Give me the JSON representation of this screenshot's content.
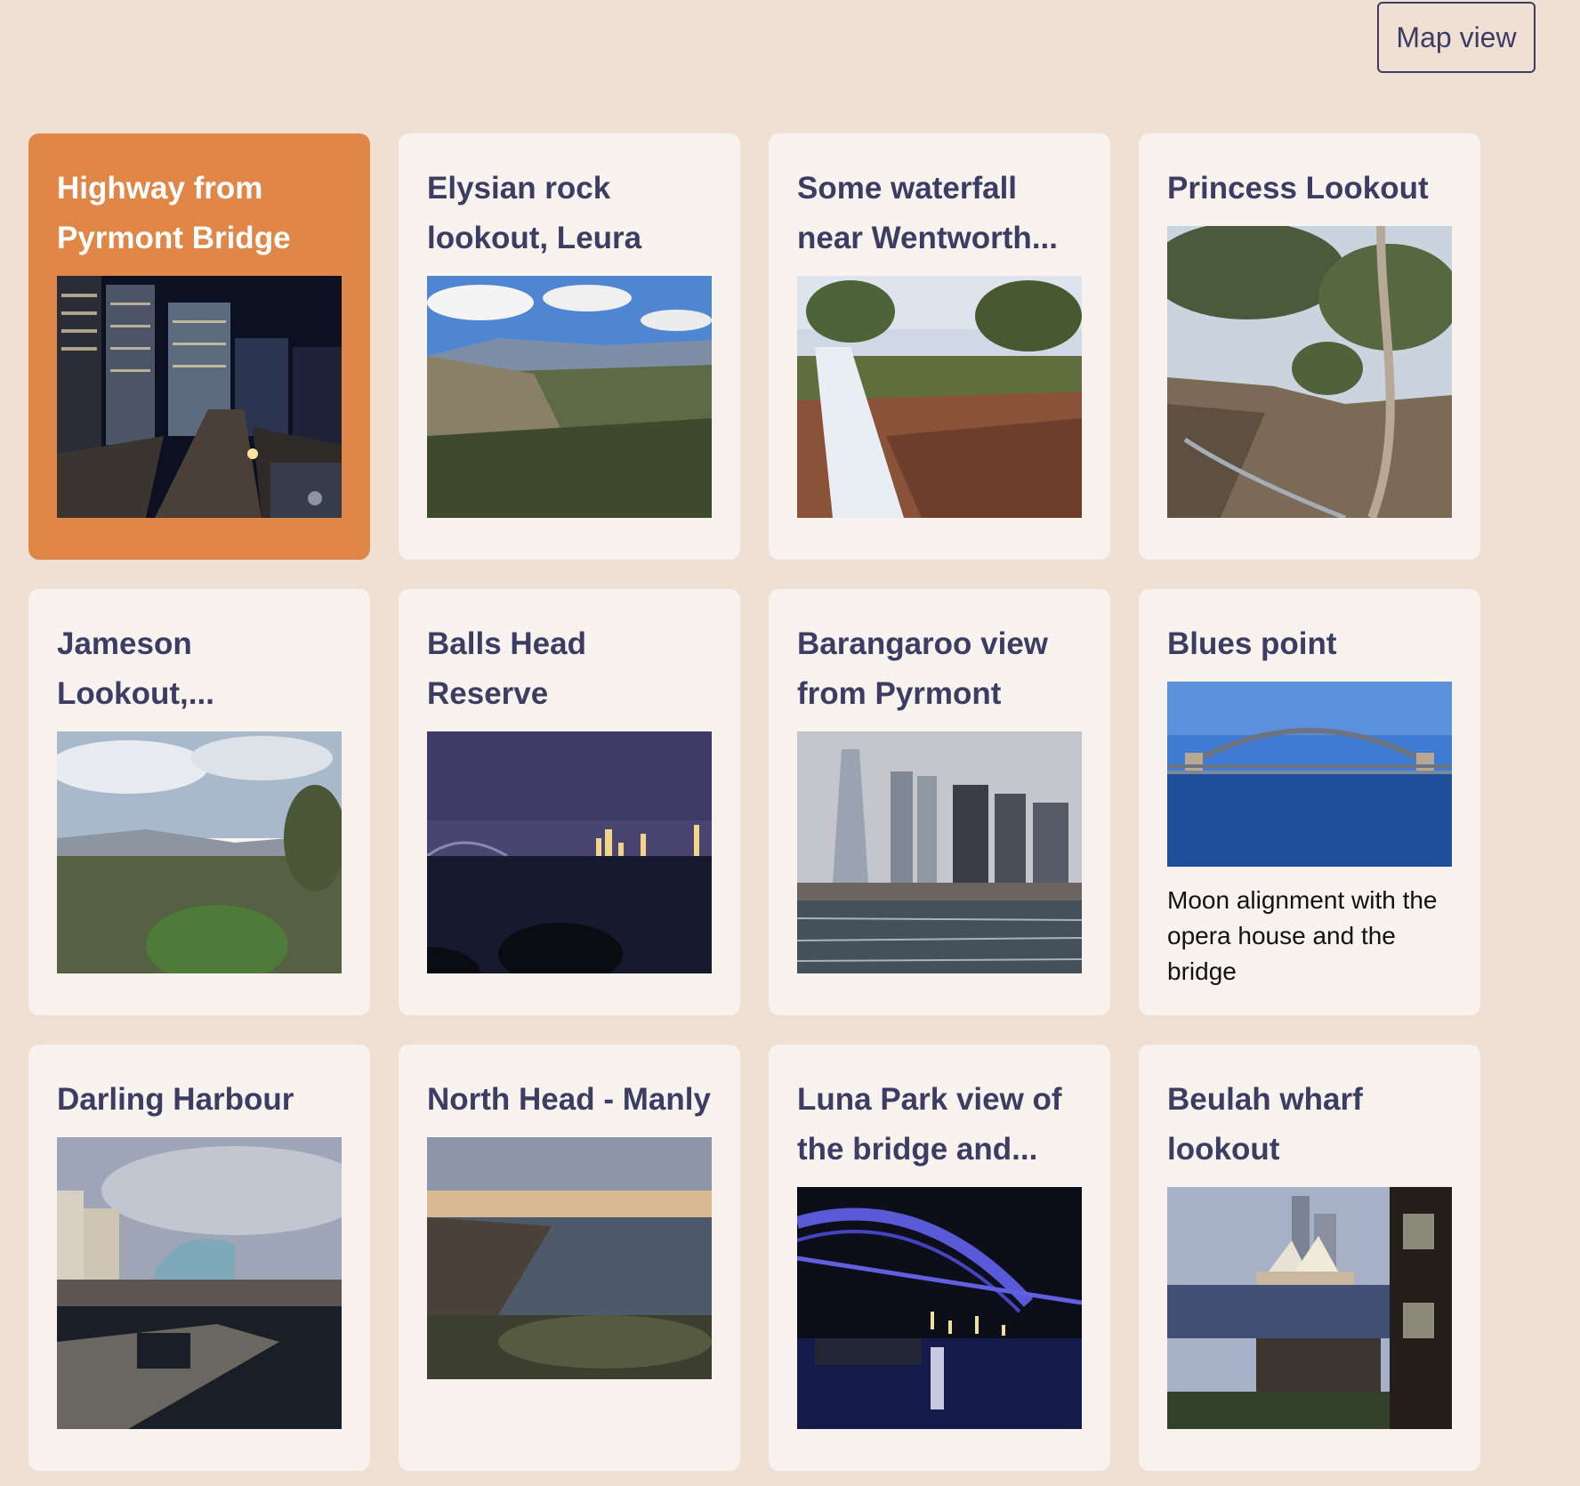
{
  "toolbar": {
    "map_view_label": "Map view"
  },
  "cards": [
    {
      "title": "Highway from Pyrmont Bridge",
      "active": true,
      "description": ""
    },
    {
      "title": "Elysian rock lookout, Leura",
      "active": false,
      "description": ""
    },
    {
      "title": "Some waterfall near Wentworth...",
      "active": false,
      "description": ""
    },
    {
      "title": "Princess Lookout",
      "active": false,
      "description": ""
    },
    {
      "title": "Jameson Lookout,...",
      "active": false,
      "description": ""
    },
    {
      "title": "Balls Head Reserve",
      "active": false,
      "description": ""
    },
    {
      "title": "Barangaroo view from Pyrmont",
      "active": false,
      "description": ""
    },
    {
      "title": "Blues point",
      "active": false,
      "description": "Moon alignment with the opera house and the bridge"
    },
    {
      "title": "Darling Harbour",
      "active": false,
      "description": ""
    },
    {
      "title": "North Head - Manly",
      "active": false,
      "description": ""
    },
    {
      "title": "Luna Park view of the bridge and...",
      "active": false,
      "description": ""
    },
    {
      "title": "Beulah wharf lookout",
      "active": false,
      "description": ""
    }
  ]
}
